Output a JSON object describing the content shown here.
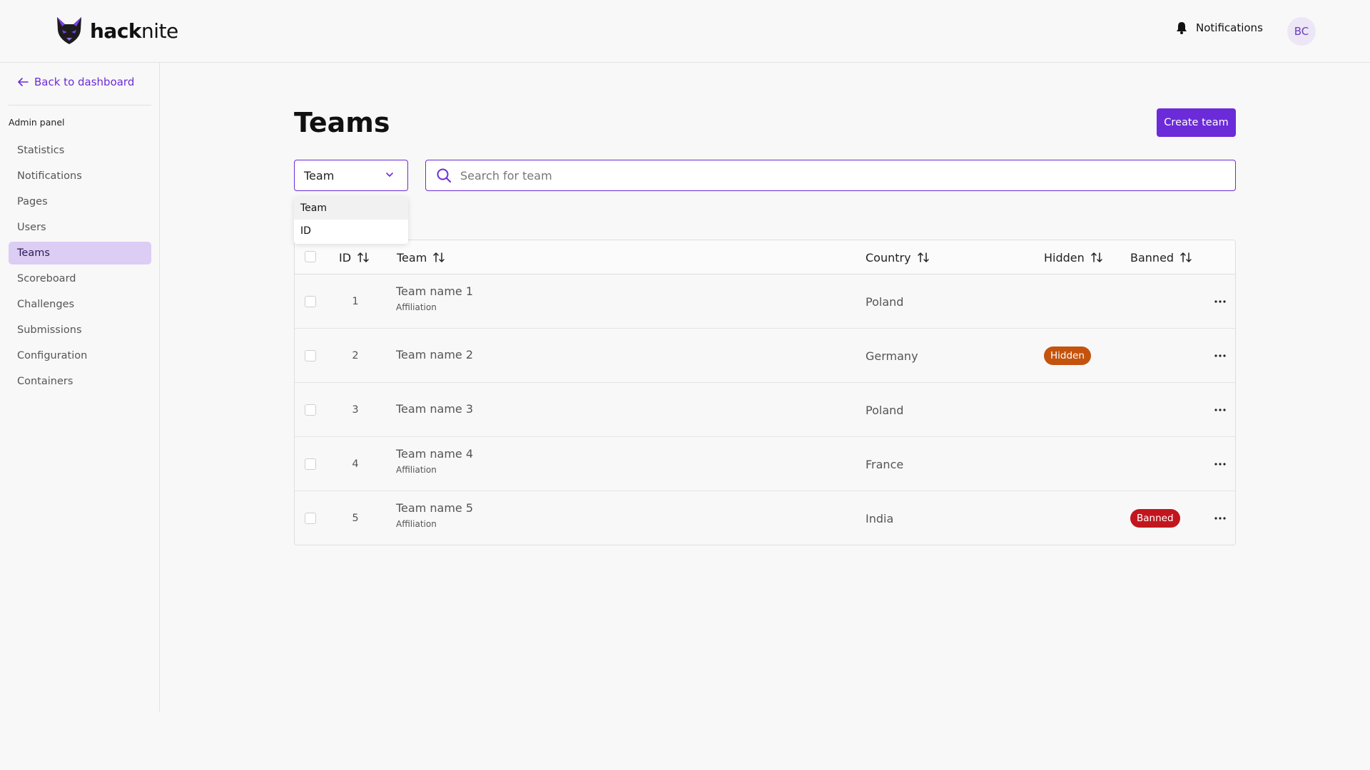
{
  "app": {
    "name_bold": "hack",
    "name_light": "nite"
  },
  "header": {
    "notifications_label": "Notifications",
    "avatar_initials": "BC"
  },
  "sidebar": {
    "back_label": "Back to dashboard",
    "section_title": "Admin panel",
    "items": [
      {
        "label": "Statistics",
        "active": false
      },
      {
        "label": "Notifications",
        "active": false
      },
      {
        "label": "Pages",
        "active": false
      },
      {
        "label": "Users",
        "active": false
      },
      {
        "label": "Teams",
        "active": true
      },
      {
        "label": "Scoreboard",
        "active": false
      },
      {
        "label": "Challenges",
        "active": false
      },
      {
        "label": "Submissions",
        "active": false
      },
      {
        "label": "Configuration",
        "active": false
      },
      {
        "label": "Containers",
        "active": false
      }
    ]
  },
  "main": {
    "title": "Teams",
    "create_button": "Create team",
    "filter": {
      "selected": "Team",
      "options": [
        "Team",
        "ID"
      ]
    },
    "search": {
      "placeholder": "Search for team",
      "value": ""
    }
  },
  "table": {
    "columns": {
      "id": "ID",
      "team": "Team",
      "country": "Country",
      "hidden": "Hidden",
      "banned": "Banned"
    },
    "rows": [
      {
        "id": "1",
        "name": "Team name 1",
        "affiliation": "Affiliation",
        "country": "Poland",
        "hidden": "",
        "banned": ""
      },
      {
        "id": "2",
        "name": "Team name 2",
        "affiliation": "",
        "country": "Germany",
        "hidden": "Hidden",
        "banned": ""
      },
      {
        "id": "3",
        "name": "Team name 3",
        "affiliation": "",
        "country": "Poland",
        "hidden": "",
        "banned": ""
      },
      {
        "id": "4",
        "name": "Team name 4",
        "affiliation": "Affiliation",
        "country": "France",
        "hidden": "",
        "banned": ""
      },
      {
        "id": "5",
        "name": "Team name 5",
        "affiliation": "Affiliation",
        "country": "India",
        "hidden": "",
        "banned": "Banned"
      }
    ]
  },
  "colors": {
    "accent": "#6c2bd9",
    "sidebar_active_bg": "#dccdf4",
    "hidden_badge": "#c4530d",
    "banned_badge": "#c2161f"
  },
  "icons": {
    "logo": "fox-logo-icon",
    "notifications": "bell-icon",
    "back": "arrow-left-icon",
    "filter": "chevron-down-icon",
    "search": "search-icon",
    "sort": "sort-arrows-icon",
    "row_menu": "more-horizontal-icon"
  }
}
